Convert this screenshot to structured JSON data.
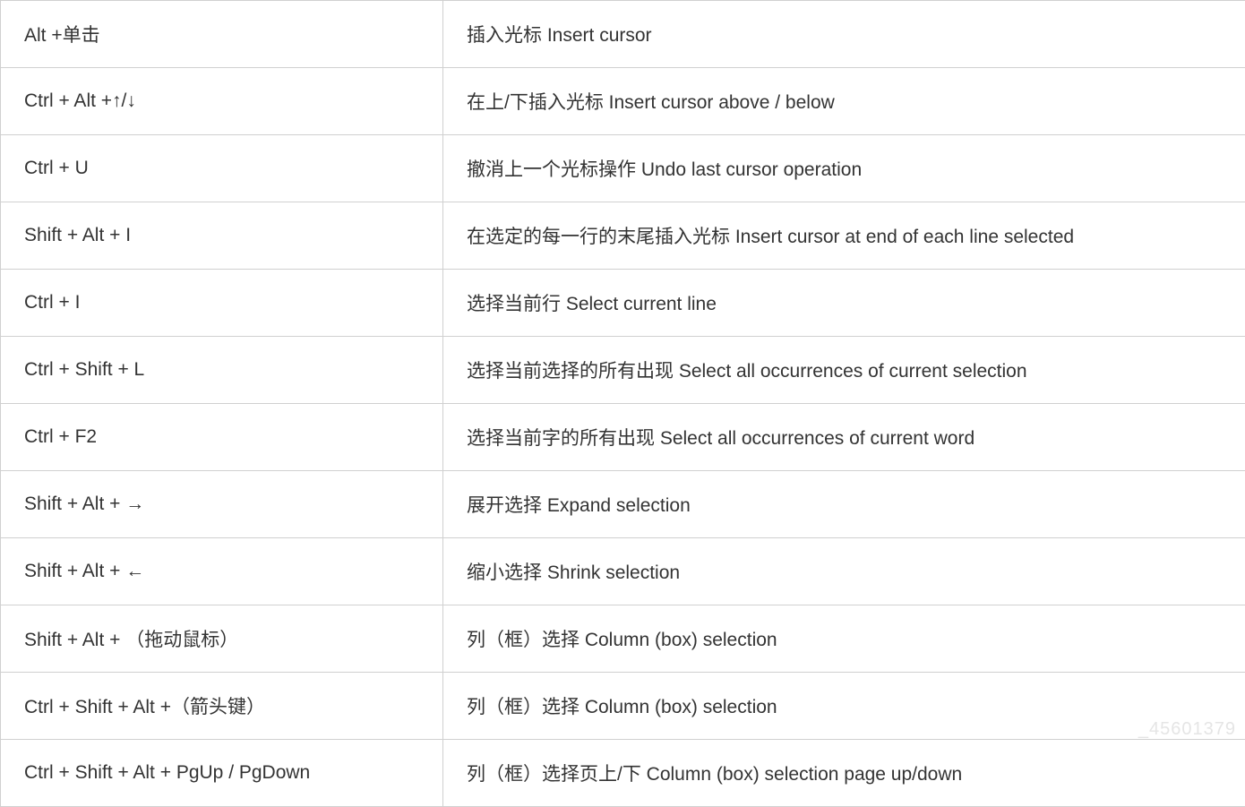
{
  "shortcuts": [
    {
      "key": "Alt +单击",
      "description": "插入光标 Insert cursor"
    },
    {
      "key": "Ctrl + Alt +↑/↓",
      "description": "在上/下插入光标 Insert cursor above / below"
    },
    {
      "key": "Ctrl + U",
      "description": "撤消上一个光标操作 Undo last cursor operation"
    },
    {
      "key": "Shift + Alt + I",
      "description": "在选定的每一行的末尾插入光标 Insert cursor at end of each line selected"
    },
    {
      "key": "Ctrl + I",
      "description": "选择当前行 Select current line"
    },
    {
      "key": "Ctrl + Shift + L",
      "description": "选择当前选择的所有出现 Select all occurrences of current selection"
    },
    {
      "key": "Ctrl + F2",
      "description": "选择当前字的所有出现 Select all occurrences of current word"
    },
    {
      "key": "Shift + Alt + →",
      "description": "展开选择 Expand selection"
    },
    {
      "key": "Shift + Alt + ←",
      "description": "缩小选择 Shrink selection"
    },
    {
      "key": "Shift + Alt + （拖动鼠标）",
      "description": "列（框）选择 Column (box) selection"
    },
    {
      "key": "Ctrl + Shift + Alt +（箭头键）",
      "description": "列（框）选择 Column (box) selection"
    },
    {
      "key": "Ctrl + Shift + Alt + PgUp / PgDown",
      "description": "列（框）选择页上/下 Column (box) selection page up/down"
    }
  ],
  "watermark": "_45601379"
}
